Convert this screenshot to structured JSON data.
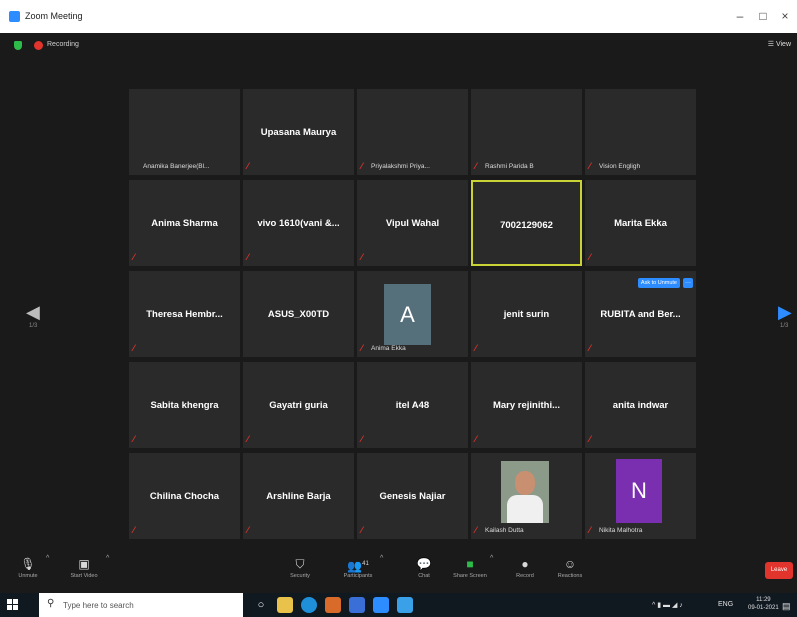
{
  "window": {
    "title": "Zoom Meeting",
    "minimize": "–",
    "maximize": "□",
    "close": "×"
  },
  "meeting": {
    "recording_label": "Recording",
    "view_label": "View"
  },
  "nav": {
    "left_arrow": "◀",
    "right_arrow": "▶",
    "left_page": "1/3",
    "right_page": "1/3"
  },
  "tiles": [
    {
      "name": "",
      "label": "Anamika Banerjee(Bl...",
      "muted": false
    },
    {
      "name": "Upasana Maurya",
      "label": "",
      "muted": true
    },
    {
      "name": "",
      "label": "Priyalakshmi Priya...",
      "muted": true
    },
    {
      "name": "",
      "label": "Rashmi Parida B",
      "muted": true
    },
    {
      "name": "",
      "label": "Vision Engligh",
      "muted": true
    },
    {
      "name": "Anima Sharma",
      "label": "",
      "muted": true
    },
    {
      "name": "vivo 1610(vani &...",
      "label": "",
      "muted": true
    },
    {
      "name": "Vipul Wahal",
      "label": "",
      "muted": true
    },
    {
      "name": "7002129062",
      "label": "",
      "muted": false,
      "active": true
    },
    {
      "name": "Marita Ekka",
      "label": "",
      "muted": true
    },
    {
      "name": "Theresa Hembr...",
      "label": "",
      "muted": true
    },
    {
      "name": "ASUS_X00TD",
      "label": "",
      "muted": false
    },
    {
      "name": "",
      "label": "Anima Ekka",
      "muted": true,
      "avatar": "A"
    },
    {
      "name": "jenit surin",
      "label": "",
      "muted": true
    },
    {
      "name": "RUBITA and Ber...",
      "label": "",
      "muted": true,
      "pill": "Ask to Unmute",
      "pill_more": "···"
    },
    {
      "name": "Sabita khengra",
      "label": "",
      "muted": true
    },
    {
      "name": "Gayatri guria",
      "label": "",
      "muted": true
    },
    {
      "name": "itel A48",
      "label": "",
      "muted": true
    },
    {
      "name": "Mary rejinithi...",
      "label": "",
      "muted": true
    },
    {
      "name": "anita indwar",
      "label": "",
      "muted": true
    },
    {
      "name": "Chilina Chocha",
      "label": "",
      "muted": true
    },
    {
      "name": "Arshline Barja",
      "label": "",
      "muted": true
    },
    {
      "name": "Genesis Najiar",
      "label": "",
      "muted": true
    },
    {
      "name": "",
      "label": "Kailash Dutta",
      "muted": true,
      "photo": true
    },
    {
      "name": "",
      "label": "Nikita Malhotra",
      "muted": true,
      "avatar": "N"
    }
  ],
  "toolbar": {
    "unmute": "Unmute",
    "start_video": "Start Video",
    "security": "Security",
    "participants": "Participants",
    "participants_count": "41",
    "chat": "Chat",
    "share_screen": "Share Screen",
    "record": "Record",
    "reactions": "Reactions",
    "end": "Leave"
  },
  "taskbar": {
    "search_placeholder": "Type here to search",
    "lang": "ENG",
    "time": "11:29",
    "date": "09-01-2021"
  },
  "colors": {
    "accent": "#2d8cff",
    "mute": "#e0342c",
    "active_border": "#c9d336",
    "share_green": "#2dbc4a"
  }
}
